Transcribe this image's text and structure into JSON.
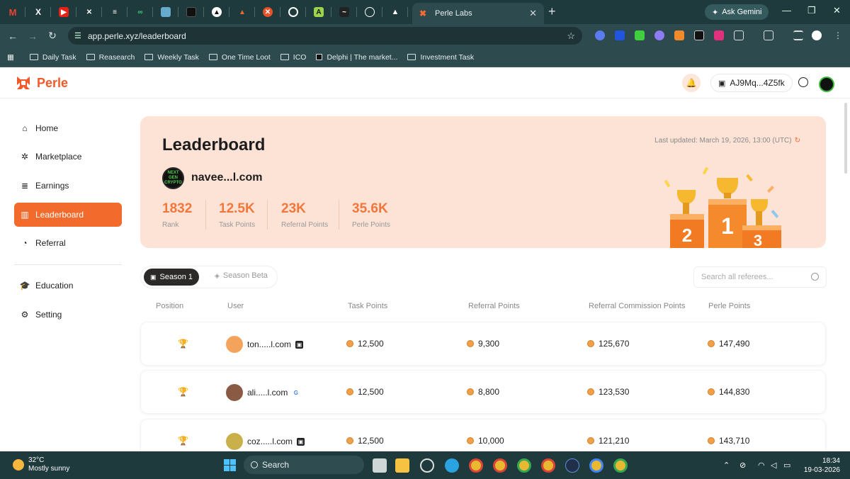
{
  "browser": {
    "active_tab_title": "Perle Labs",
    "ask_gemini": "Ask Gemini",
    "url": "app.perle.xyz/leaderboard",
    "bookmarks": [
      "Daily Task",
      "Reasearch",
      "Weekly Task",
      "One Time Loot",
      "ICO",
      "Delphi | The market...",
      "Investment Task"
    ]
  },
  "app": {
    "brand": "Perle",
    "wallet": "AJ9Mq...4Z5fk",
    "accent_color": "#f26b2c"
  },
  "sidebar": {
    "items": [
      {
        "label": "Home",
        "icon": "home-icon"
      },
      {
        "label": "Marketplace",
        "icon": "marketplace-icon"
      },
      {
        "label": "Earnings",
        "icon": "earnings-icon"
      },
      {
        "label": "Leaderboard",
        "icon": "leaderboard-icon",
        "active": true
      },
      {
        "label": "Referral",
        "icon": "referral-icon"
      },
      {
        "label": "Education",
        "icon": "education-icon"
      },
      {
        "label": "Setting",
        "icon": "gear-icon"
      }
    ]
  },
  "banner": {
    "title": "Leaderboard",
    "last_updated": "Last updated: March 19, 2026, 13:00 (UTC)",
    "username": "navee...l.com",
    "avatar_text": "NEXT GEN CRYPTO",
    "stats": [
      {
        "value": "1832",
        "label": "Rank"
      },
      {
        "value": "12.5K",
        "label": "Task Points"
      },
      {
        "value": "23K",
        "label": "Referral Points"
      },
      {
        "value": "35.6K",
        "label": "Perle Points"
      }
    ]
  },
  "seasons": {
    "active": "Season 1",
    "other": "Season Beta"
  },
  "search": {
    "placeholder": "Search all referees..."
  },
  "table": {
    "headers": [
      "Position",
      "User",
      "Task Points",
      "Referral Points",
      "Referral Commission Points",
      "Perle Points"
    ],
    "rows": [
      {
        "user": "ton.....l.com",
        "task": "12,500",
        "referral": "9,300",
        "commission": "125,670",
        "perle": "147,490",
        "trophy": "gold"
      },
      {
        "user": "ali.....l.com",
        "task": "12,500",
        "referral": "8,800",
        "commission": "123,530",
        "perle": "144,830",
        "trophy": "silver"
      },
      {
        "user": "coz.....l.com",
        "task": "12,500",
        "referral": "10,000",
        "commission": "121,210",
        "perle": "143,710",
        "trophy": "bronze"
      }
    ]
  },
  "taskbar": {
    "temp": "32°C",
    "weather": "Mostly sunny",
    "search": "Search",
    "time": "18:34",
    "date": "19-03-2026"
  }
}
